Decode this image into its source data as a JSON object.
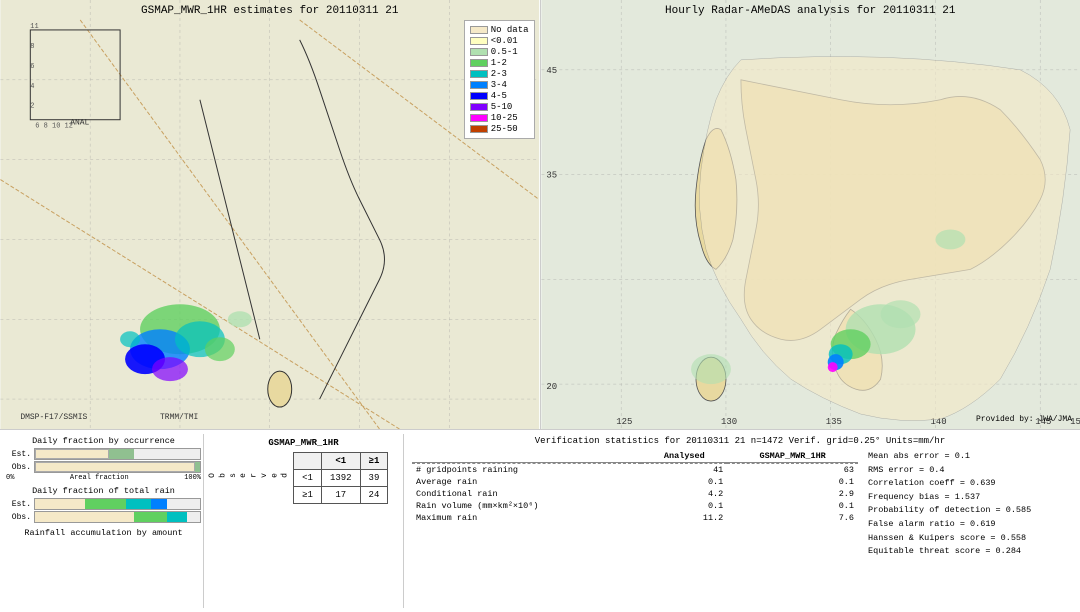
{
  "left_map": {
    "title": "GSMAP_MWR_1HR estimates for 20110311 21",
    "satellite_label": "DMSP-F17/SSMIS",
    "other_label": "TRMM/TMI",
    "anal_label": "ANAL"
  },
  "right_map": {
    "title": "Hourly Radar-AMeDAS analysis for 20110311 21",
    "provided_label": "Provided by: JWA/JMA",
    "lat_labels": [
      "45",
      "35",
      "20"
    ],
    "lon_labels": [
      "125",
      "130",
      "135",
      "140",
      "145"
    ]
  },
  "legend": {
    "title": "No data",
    "items": [
      {
        "label": "No data",
        "color": "#f5e9c8"
      },
      {
        "label": "<0.01",
        "color": "#ffffc0"
      },
      {
        "label": "0.5-1",
        "color": "#b0e0b0"
      },
      {
        "label": "1-2",
        "color": "#60d060"
      },
      {
        "label": "2-3",
        "color": "#00c0c0"
      },
      {
        "label": "3-4",
        "color": "#0080ff"
      },
      {
        "label": "4-5",
        "color": "#0000ff"
      },
      {
        "label": "5-10",
        "color": "#8000ff"
      },
      {
        "label": "10-25",
        "color": "#ff00ff"
      },
      {
        "label": "25-50",
        "color": "#c04000"
      }
    ]
  },
  "bar_charts": {
    "occurrence_title": "Daily fraction by occurrence",
    "rain_title": "Daily fraction of total rain",
    "accumulation_title": "Rainfall accumulation by amount",
    "est_label": "Est.",
    "obs_label": "Obs.",
    "axis_start": "0%",
    "axis_end": "100%",
    "axis_label": "Areal fraction"
  },
  "contingency": {
    "title": "GSMAP_MWR_1HR",
    "col_lt1": "<1",
    "col_ge1": "≥1",
    "row_lt1": "<1",
    "row_ge1": "≥1",
    "observed_label": "O\nb\ns\ne\nr\nv\ne\nd",
    "values": {
      "lt1_lt1": "1392",
      "lt1_ge1": "39",
      "ge1_lt1": "17",
      "ge1_ge1": "24"
    }
  },
  "verification": {
    "title": "Verification statistics for 20110311 21  n=1472  Verif. grid=0.25°  Units=mm/hr",
    "col_analysed": "Analysed",
    "col_gsmap": "GSMAP_MWR_1HR",
    "rows": [
      {
        "label": "# gridpoints raining",
        "analysed": "41",
        "gsmap": "63"
      },
      {
        "label": "Average rain",
        "analysed": "0.1",
        "gsmap": "0.1"
      },
      {
        "label": "Conditional rain",
        "analysed": "4.2",
        "gsmap": "2.9"
      },
      {
        "label": "Rain volume (mm×km²×10⁶)",
        "analysed": "0.1",
        "gsmap": "0.1"
      },
      {
        "label": "Maximum rain",
        "analysed": "11.2",
        "gsmap": "7.6"
      }
    ],
    "stats": [
      {
        "label": "Mean abs error",
        "value": "0.1"
      },
      {
        "label": "RMS error",
        "value": "0.4"
      },
      {
        "label": "Correlation coeff",
        "value": "0.639"
      },
      {
        "label": "Frequency bias",
        "value": "1.537"
      },
      {
        "label": "Probability of detection",
        "value": "0.585"
      },
      {
        "label": "False alarm ratio",
        "value": "0.619"
      },
      {
        "label": "Hanssen & Kuipers score",
        "value": "0.558"
      },
      {
        "label": "Equitable threat score",
        "value": "0.284"
      }
    ]
  }
}
